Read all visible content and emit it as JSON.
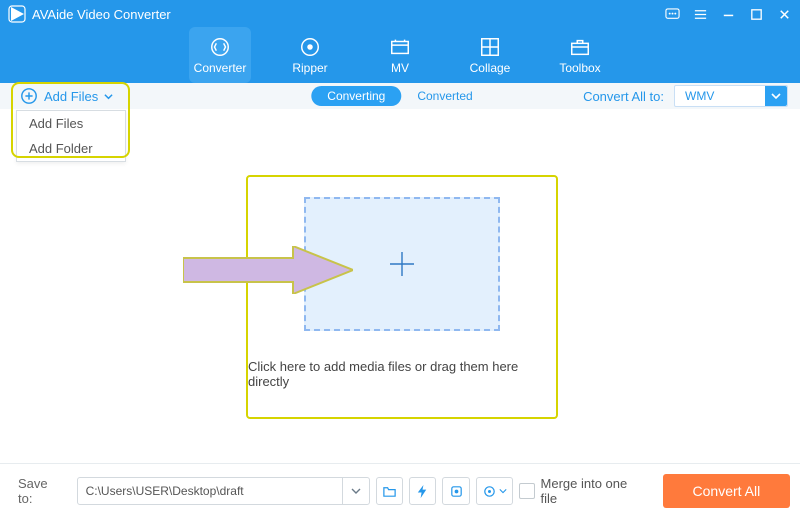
{
  "app": {
    "title": "AVAide Video Converter"
  },
  "tabs": {
    "converter": "Converter",
    "ripper": "Ripper",
    "mv": "MV",
    "collage": "Collage",
    "toolbox": "Toolbox"
  },
  "subbar": {
    "add_files": "Add Files",
    "menu": {
      "add_files": "Add Files",
      "add_folder": "Add Folder"
    },
    "seg_converting": "Converting",
    "seg_converted": "Converted",
    "convert_all_to_label": "Convert All to:",
    "format_selected": "WMV"
  },
  "dropzone": {
    "instruction": "Click here to add media files or drag them here directly"
  },
  "footer": {
    "save_to_label": "Save to:",
    "path": "C:\\Users\\USER\\Desktop\\draft",
    "merge_label": "Merge into one file",
    "convert_all": "Convert All"
  }
}
